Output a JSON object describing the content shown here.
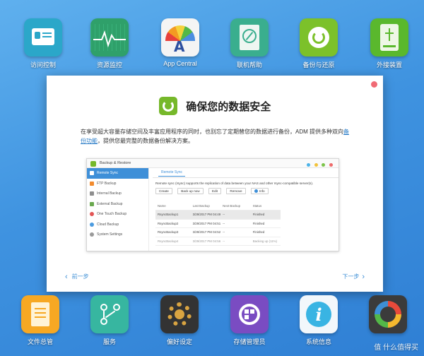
{
  "desktop": {
    "top_icons": [
      {
        "label": "访问控制",
        "icon": "id-card-icon",
        "color": "#2ba7c9"
      },
      {
        "label": "资源监控",
        "icon": "heartbeat-monitor-icon",
        "color": "#2fa06a"
      },
      {
        "label": "App Central",
        "icon": "app-central-icon",
        "color": "#f4f4f4"
      },
      {
        "label": "联机帮助",
        "icon": "help-compass-icon",
        "color": "#3aae8e"
      },
      {
        "label": "备份与还原",
        "icon": "backup-restore-icon",
        "color": "#7cc12a"
      },
      {
        "label": "外接装置",
        "icon": "usb-drive-icon",
        "color": "#5ab82d"
      }
    ],
    "bottom_icons": [
      {
        "label": "文件总管",
        "icon": "file-explorer-icon",
        "color": "#f7a823"
      },
      {
        "label": "服务",
        "icon": "services-share-icon",
        "color": "#37b6a0"
      },
      {
        "label": "偏好设定",
        "icon": "settings-gear-icon",
        "color": "#333333"
      },
      {
        "label": "存储管理员",
        "icon": "storage-manager-icon",
        "color": "#7a4cc2"
      },
      {
        "label": "系统信息",
        "icon": "info-icon",
        "color": "#39b4e3"
      },
      {
        "label": "",
        "icon": "activity-ring-icon",
        "color": "#3b3b3b"
      }
    ]
  },
  "overlay": {
    "title": "确保您的数据安全",
    "description": "在享受超大容量存储空间及丰富应用程序的同时，也别忘了定期替您的数据进行备份，ADM 提供多种双向",
    "description_link": "备份功能",
    "description_tail": "，提供您最完整的数据备份解决方案。",
    "prev_label": "前一步",
    "next_label": "下一步",
    "preview": {
      "window_title": "Backup & Restore",
      "sidebar": [
        {
          "label": "Remote Sync",
          "active": true
        },
        {
          "label": "FTP Backup",
          "active": false
        },
        {
          "label": "Internal Backup",
          "active": false
        },
        {
          "label": "External Backup",
          "active": false
        },
        {
          "label": "One Touch Backup",
          "active": false
        },
        {
          "label": "Cloud Backup",
          "active": false
        },
        {
          "label": "System Settings",
          "active": false
        }
      ],
      "tab": "Remote Sync",
      "description": "Remote sync (rsync) supports the replication of data between your NAS and other rsync-compatible server(s).",
      "buttons": [
        "Create",
        "Back up now",
        "Edit",
        "Remove",
        "Info"
      ],
      "columns": [
        "Name",
        "Last Backup",
        "Next Backup",
        "Status"
      ],
      "rows": [
        [
          "RsyncBackup1",
          "3/29/2017 PM 04:49",
          "--",
          "Finished"
        ],
        [
          "RsyncBackup2",
          "3/29/2017 PM 04:51",
          "--",
          "Finished"
        ],
        [
          "RsyncBackup3",
          "3/29/2017 PM 04:52",
          "--",
          "Finished"
        ],
        [
          "RsyncBackup4",
          "3/29/2017 PM 04:56",
          "--",
          "Backing up (11%)"
        ]
      ]
    }
  },
  "watermark": "值 什么值得买"
}
